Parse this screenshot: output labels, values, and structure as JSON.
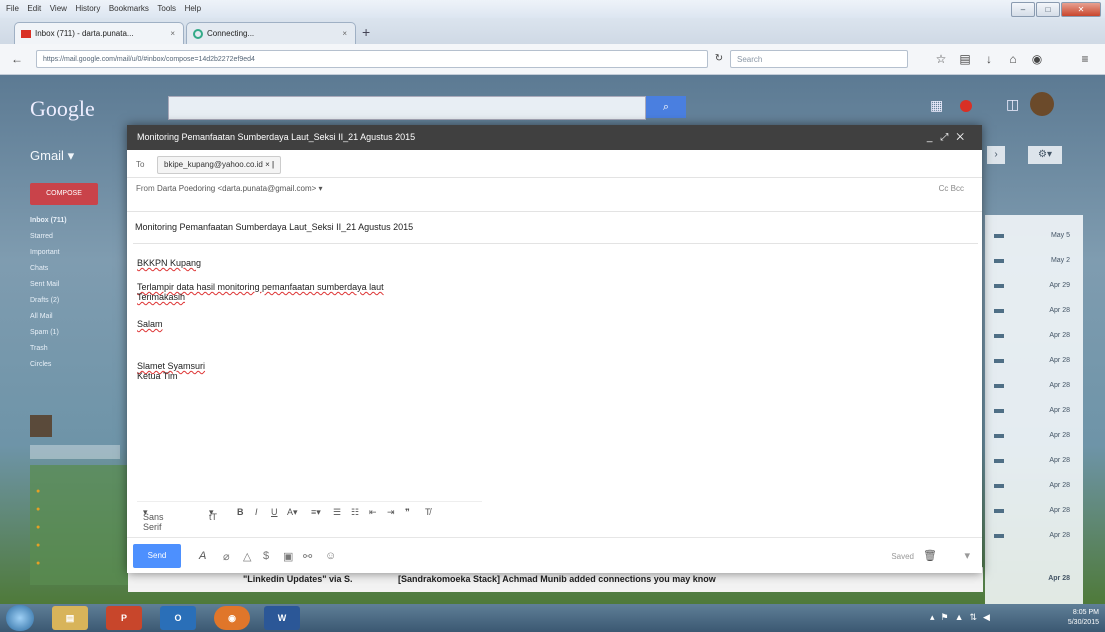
{
  "menubar": {
    "items": [
      "File",
      "Edit",
      "View",
      "History",
      "Bookmarks",
      "Tools",
      "Help"
    ]
  },
  "tabs": [
    {
      "label": "Inbox (711) - darta.punata..."
    },
    {
      "label": "Connecting..."
    }
  ],
  "nav": {
    "url": "https://mail.google.com/mail/u/0/#inbox/compose=14d2b2272ef9ed4",
    "search_placeholder": "Search"
  },
  "gmail": {
    "logo": "Google",
    "product": "Gmail",
    "compose_label": "COMPOSE",
    "labels": [
      "Inbox (711)",
      "Starred",
      "Important",
      "Chats",
      "Sent Mail",
      "Drafts (2)",
      "All Mail",
      "Spam (1)",
      "Trash",
      "Circles"
    ],
    "dates": [
      "May 5",
      "May 2",
      "Apr 29",
      "Apr 28",
      "Apr 28",
      "Apr 28",
      "Apr 28",
      "Apr 28",
      "Apr 28",
      "Apr 28",
      "Apr 28",
      "Apr 28",
      "Apr 28",
      "Apr 28"
    ],
    "bottom_row": {
      "sender": "\"Linkedin Updates\" via S.",
      "subject": "[Sandrakomoeka Stack] Achmad Munib added connections you may know"
    }
  },
  "compose": {
    "title": "Monitoring Pemanfaatan Sumberdaya Laut_Seksi II_21 Agustus 2015",
    "to_label": "To",
    "to_value": "bkipe_kupang@yahoo.co.id",
    "from_label": "From",
    "from_value": "Darta Poedoring <darta.punata@gmail.com>",
    "cc_bcc": "Cc Bcc",
    "subject": "Monitoring Pemanfaatan Sumberdaya Laut_Seksi II_21 Agustus 2015",
    "body": {
      "greeting": "BKKPN Kupang",
      "line1": "Terlampir data hasil monitoring pemanfaatan sumberdaya laut",
      "line2": "Terimakasih",
      "closing": "Salam",
      "signer_name": "Slamet Syamsuri",
      "signer_title": "Ketua Tim"
    },
    "format_font": "Sans Serif",
    "format_size": "tT",
    "send_label": "Send",
    "saved_label": "Saved"
  },
  "taskbar": {
    "time": "8:05 PM",
    "date": "5/30/2015",
    "apps": [
      "P",
      "O",
      "W"
    ]
  }
}
